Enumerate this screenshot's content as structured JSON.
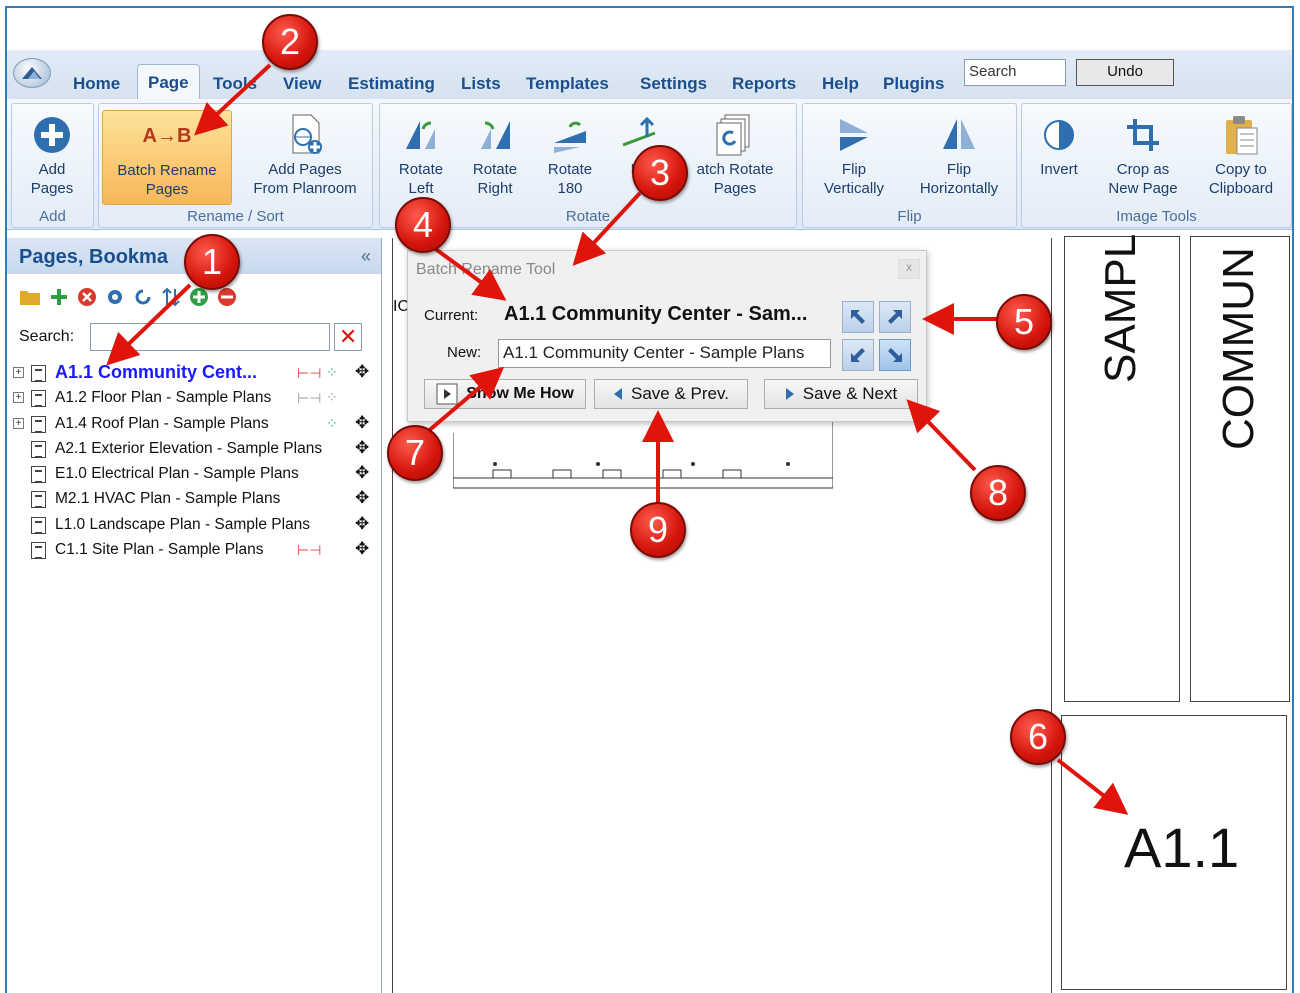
{
  "ribbon_tabs": [
    "Home",
    "Page",
    "Tools",
    "View",
    "Estimating",
    "Lists",
    "Templates",
    "Settings",
    "Reports",
    "Help",
    "Plugins"
  ],
  "search_placeholder": "Search",
  "undo_label": "Undo",
  "ribbon": {
    "add_pages": "Add\nPages",
    "batch_rename": "Batch Rename\nPages",
    "add_from_planroom": "Add Pages\nFrom Planroom",
    "rotate_left": "Rotate\nLeft",
    "rotate_right": "Rotate\nRight",
    "rotate_180": "Rotate\n180",
    "level": "Le",
    "batch_rotate": "atch Rotate\nPages",
    "flip_vertically": "Flip\nVertically",
    "flip_horizontally": "Flip\nHorizontally",
    "invert": "Invert",
    "crop_new_page": "Crop as\nNew Page",
    "copy_clipboard": "Copy to\nClipboard",
    "group_add": "Add",
    "group_rename": "Rename / Sort",
    "group_rotate": "Rotate",
    "group_flip": "Flip",
    "group_image": "Image Tools",
    "batch_rename_icon_text": "A→B"
  },
  "left_panel": {
    "title": "Pages, Bookma",
    "collapse": "«",
    "search_label": "Search:",
    "pages": [
      "A1.1 Community Cent...",
      "A1.2 Floor Plan - Sample Plans",
      "A1.4 Roof Plan - Sample Plans",
      "A2.1 Exterior Elevation - Sample Plans",
      "E1.0 Electrical Plan - Sample Plans",
      "M2.1 HVAC Plan - Sample Plans",
      "L1.0 Landscape Plan - Sample Plans",
      "C1.1 Site Plan - Sample Plans"
    ]
  },
  "dialog": {
    "title": "Batch Rename Tool",
    "current_label": "Current:",
    "current_value": "A1.1 Community Center - Sam...",
    "new_label": "New:",
    "new_value": "A1.1 Community Center - Sample Plans",
    "show_me_how": "Show Me How",
    "save_prev": "Save & Prev.",
    "save_next": "Save & Next"
  },
  "canvas": {
    "title_text_1": "SAMPL",
    "title_text_2": "COMMUN",
    "sheet_number": "A1.1",
    "partial_text": "ICI"
  },
  "callouts": [
    "1",
    "2",
    "3",
    "4",
    "5",
    "6",
    "7",
    "8",
    "9"
  ],
  "colors": {
    "accent": "#1b4f8c",
    "callout": "#d3140b",
    "selected_page": "#1a1aff"
  }
}
